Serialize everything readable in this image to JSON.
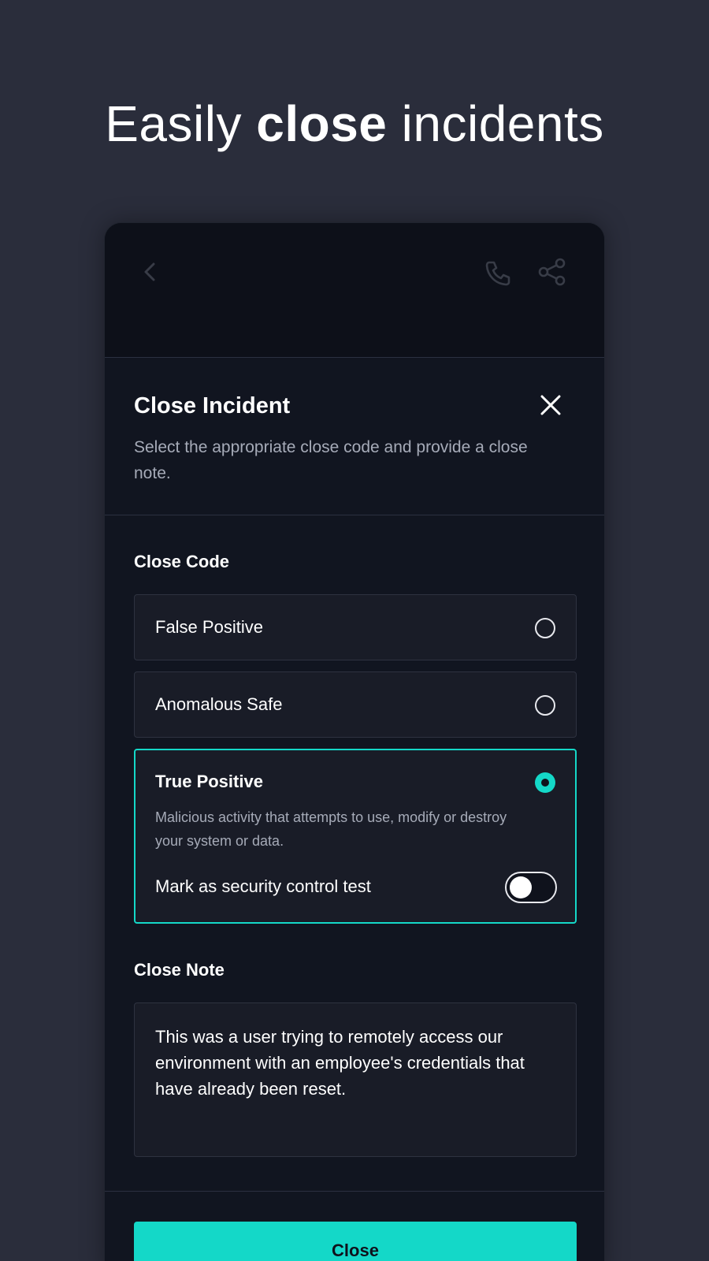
{
  "headline": {
    "prefix": "Easily ",
    "strong": "close",
    "suffix": " incidents"
  },
  "dialog": {
    "title": "Close Incident",
    "subtitle": "Select the appropriate close code and provide a close note.",
    "close_code_label": "Close Code",
    "options": [
      {
        "label": "False Positive",
        "selected": false
      },
      {
        "label": "Anomalous Safe",
        "selected": false
      },
      {
        "label": "True Positive",
        "selected": true,
        "description": "Malicious activity that attempts to use, modify or destroy your system or data.",
        "toggle_label": "Mark as security control test",
        "toggle_on": false
      }
    ],
    "close_note_label": "Close Note",
    "close_note_value": "This was a user trying to remotely access our environment with an employee's credentials that have already been reset.",
    "submit_label": "Close"
  },
  "colors": {
    "accent": "#14d8c8",
    "background": "#2a2d3b",
    "panel": "#111520",
    "field": "#191c27"
  },
  "icons": {
    "back": "chevron-left-icon",
    "call": "phone-icon",
    "share": "share-icon",
    "dismiss": "close-icon"
  }
}
